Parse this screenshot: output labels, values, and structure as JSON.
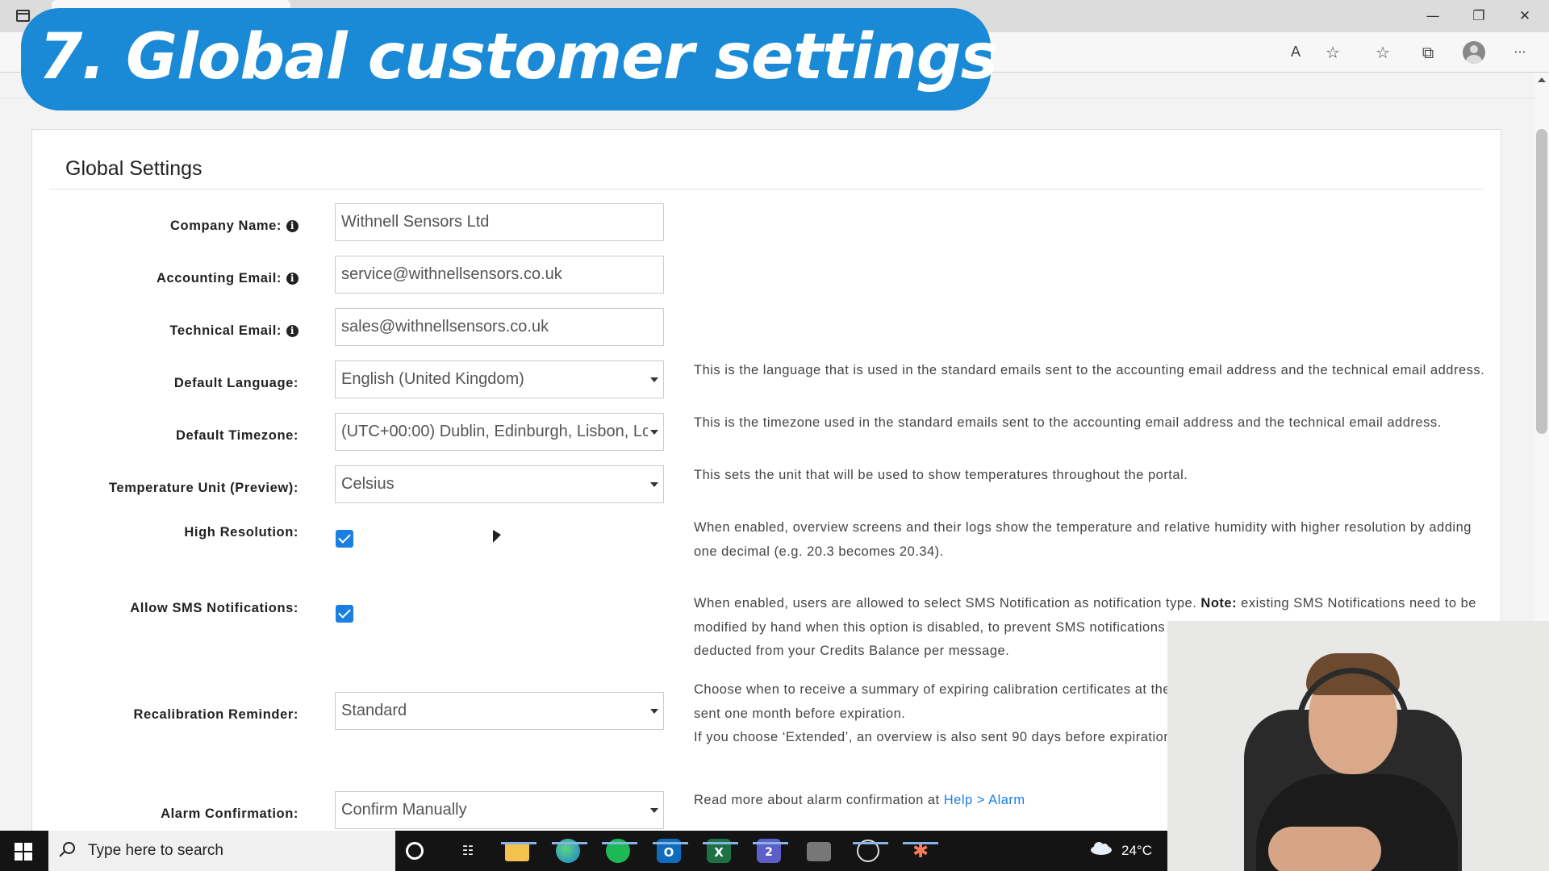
{
  "overlay_title": "7. Global customer settings",
  "window_controls": {
    "minimize": "—",
    "restore": "❐",
    "close": "✕"
  },
  "browser_icons": [
    "read-aloud-icon",
    "add-favorite-icon",
    "favorites-icon",
    "collections-icon",
    "profile-icon",
    "more-icon"
  ],
  "browser_icon_glyphs": {
    "read_aloud": "A",
    "add_favorite": "☆",
    "favorites": "☆",
    "collections": "⧉",
    "more": "···"
  },
  "panel": {
    "title": "Global Settings"
  },
  "form": {
    "company_name": {
      "label": "Company Name:",
      "value": "Withnell Sensors Ltd"
    },
    "accounting_email": {
      "label": "Accounting Email:",
      "value": "service@withnellsensors.co.uk"
    },
    "technical_email": {
      "label": "Technical Email:",
      "value": "sales@withnellsensors.co.uk"
    },
    "default_language": {
      "label": "Default Language:",
      "value": "English (United Kingdom)",
      "help": "This is the language that is used in the standard emails sent to the accounting email address and the technical email address."
    },
    "default_timezone": {
      "label": "Default Timezone:",
      "value": "(UTC+00:00) Dublin, Edinburgh, Lisbon, Lc",
      "help": "This is the timezone used in the standard emails sent to the accounting email address and the technical email address."
    },
    "temperature_unit": {
      "label": "Temperature Unit (Preview):",
      "value": "Celsius",
      "help": "This sets the unit that will be used to show temperatures throughout the portal."
    },
    "high_resolution": {
      "label": "High Resolution:",
      "checked": true,
      "help_1": "When enabled, overview screens and their logs show the temperature and relative humidity with higher resolution by adding",
      "help_2": "one decimal (e.g. 20.3 becomes 20.34)."
    },
    "allow_sms": {
      "label": "Allow SMS Notifications:",
      "checked": true,
      "help_1a": "When enabled, users are allowed to select SMS Notification as notification type. ",
      "help_1b": "Note:",
      "help_1c": " existing SMS Notifications need to be",
      "help_2": "modified by hand when this option is disabled, to prevent SMS notifications from",
      "help_3": "deducted from your Credits Balance per message."
    },
    "recalibration_reminder": {
      "label": "Recalibration Reminder:",
      "value": "Standard",
      "help_1": "Choose when to receive a summary of expiring calibration certificates at the Tec",
      "help_2": "sent one month before expiration.",
      "help_3": "If you choose ‘Extended’, an overview is also sent 90 days before expiration."
    },
    "alarm_confirmation": {
      "label": "Alarm Confirmation:",
      "value": "Confirm Manually",
      "help": "Read more about alarm confirmation at ",
      "help_link": "Help > Alarm"
    }
  },
  "taskbar": {
    "search_placeholder": "Type here to search",
    "weather_temp": "24°C",
    "apps": [
      "cortana-icon",
      "task-view-icon",
      "file-explorer-icon",
      "edge-icon",
      "spotify-icon",
      "outlook-icon",
      "excel-icon",
      "teams-icon",
      "camera-icon",
      "recorder-icon",
      "hubspot-icon"
    ],
    "teams_badge": "2"
  }
}
